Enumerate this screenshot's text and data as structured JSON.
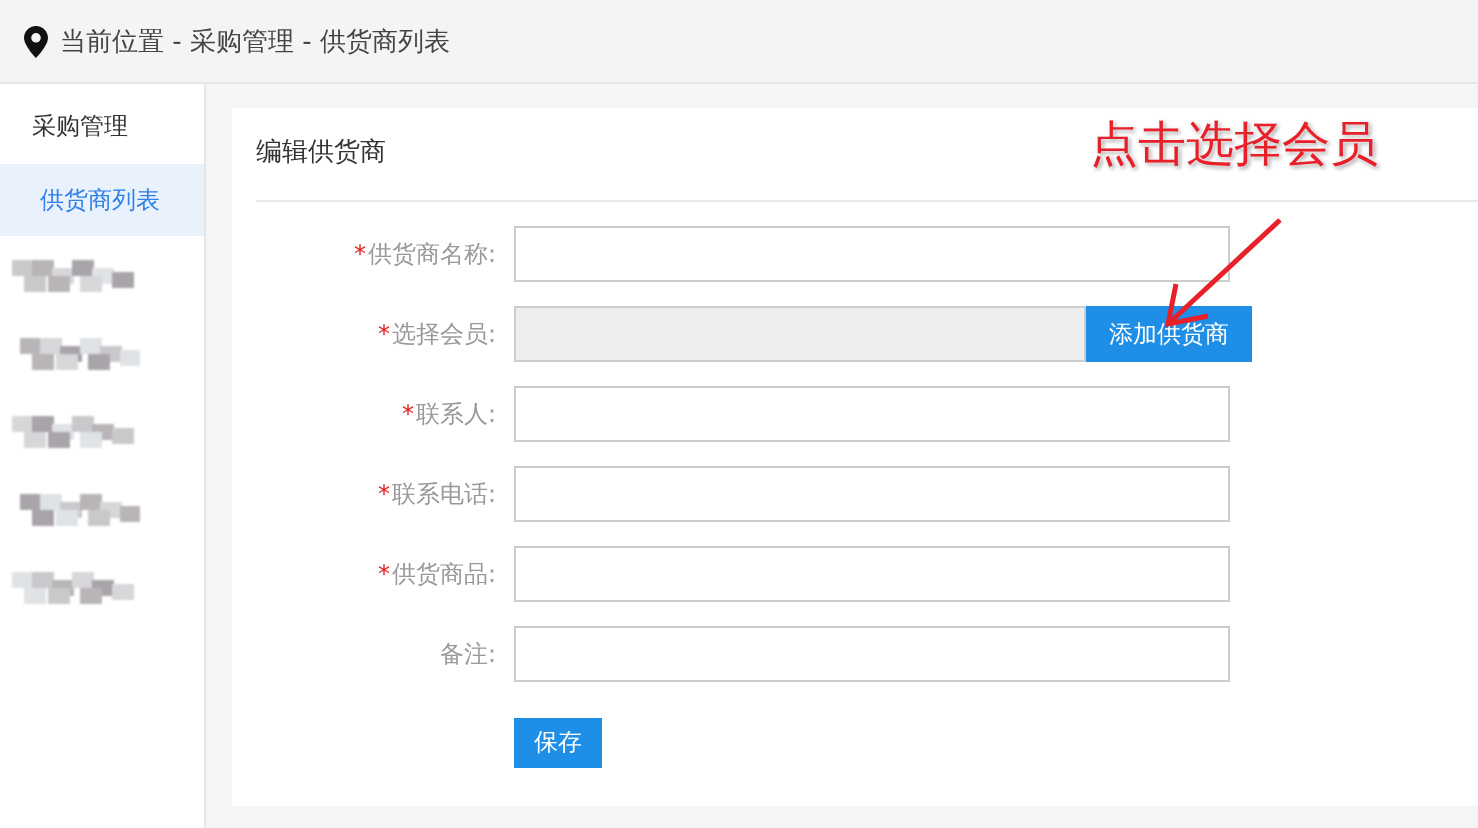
{
  "breadcrumb": "当前位置 - 采购管理 - 供货商列表",
  "sidebar": {
    "items": [
      {
        "label": "采购管理",
        "selected": false
      },
      {
        "label": "供货商列表",
        "selected": true
      }
    ],
    "obscured_items": [
      {
        "kind": "blurred"
      },
      {
        "kind": "blurred"
      },
      {
        "kind": "blurred"
      },
      {
        "kind": "blurred"
      },
      {
        "kind": "blurred"
      }
    ]
  },
  "form": {
    "title": "编辑供货商",
    "fields": [
      {
        "kind": "text",
        "label": "供货商名称:",
        "required_mark": "*"
      },
      {
        "kind": "picker",
        "label": "选择会员:",
        "required_mark": "*",
        "disabled": true,
        "button": "添加供货商"
      },
      {
        "kind": "text",
        "label": "联系人:",
        "required_mark": "*"
      },
      {
        "kind": "text",
        "label": "联系电话:",
        "required_mark": "*"
      },
      {
        "kind": "text",
        "label": "供货商品:",
        "required_mark": "*"
      },
      {
        "kind": "text",
        "label": "备注:"
      }
    ],
    "submit": "保存"
  },
  "annotation": {
    "text": "点击选择会员"
  }
}
